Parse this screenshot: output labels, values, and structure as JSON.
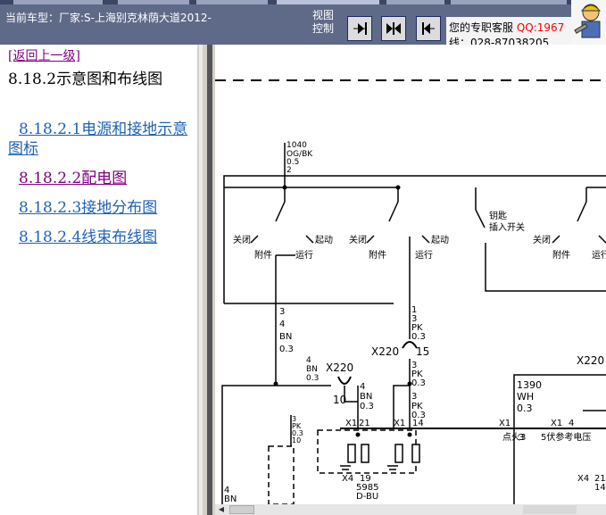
{
  "header": {
    "car_label": "当前车型：厂家:S-上海别克林荫大道2012-",
    "view_label": "视图控制",
    "contact_text": "您的专职客服",
    "qq_label": "QQ:1967",
    "phone": "线：028-87038205"
  },
  "nav_buttons": [
    {
      "name": "next-page",
      "icon": "arrow-right-bar-icon"
    },
    {
      "name": "split-view",
      "icon": "split-arrows-icon"
    },
    {
      "name": "prev-page",
      "icon": "arrow-left-bar-icon"
    }
  ],
  "sidebar": {
    "back_link": "[返回上一级]",
    "section_title": "8.18.2示意图和布线图",
    "items": [
      {
        "label": "8.18.2.1电源和接地示意图标",
        "color": "#1f62b4"
      },
      {
        "label": "8.18.2.2配电图",
        "color": "#800080"
      },
      {
        "label": "8.18.2.3接地分布图",
        "color": "#1f62b4"
      },
      {
        "label": "8.18.2.4线束布线图",
        "color": "#1f62b4"
      }
    ]
  },
  "diagram": {
    "wire_top": [
      "1040",
      "OG/BK",
      "0.5",
      "2"
    ],
    "switch_labels": {
      "off": "关闭",
      "start": "起动",
      "accessory": "附件",
      "run": "运行",
      "key_in_1": "钥匙",
      "key_in_2": "插入开关"
    },
    "wire_left": [
      "3",
      "4",
      "BN",
      "0.3"
    ],
    "wire_mid": [
      "1",
      "3",
      "PK",
      "0.3"
    ],
    "connector_x220_a": "X220",
    "connector_x220_a_pin": "15",
    "wire_mid2": [
      "3",
      "PK",
      "0.3"
    ],
    "wire_left2": [
      "4",
      "BN",
      "0.3"
    ],
    "connector_x220_b": "X220",
    "connector_x220_b_pin": "10",
    "wire_bn": [
      "4",
      "BN",
      "0.3"
    ],
    "wire_pk": [
      "3",
      "PK",
      "0.3"
    ],
    "wire_small": [
      "3",
      "PK",
      "0.3",
      "10"
    ],
    "connector_x220_c": "X220",
    "wire_right": [
      "1390",
      "WH",
      "0.3"
    ],
    "x1_a": "X1",
    "x1_a_pin": "21",
    "x1_b": "X1",
    "x1_b_pin": "14",
    "x1_c": "X1",
    "x1_c_pin": "3",
    "x1_d": "X1",
    "x1_d_pin": "4",
    "ignition_label": "点火3",
    "ref_voltage": "5伏参考电压",
    "x4_a": "X4",
    "x4_a_pin": "19",
    "x4_a_wire": [
      "5985",
      "D-BU"
    ],
    "x4_b": "X4",
    "x4_b_pin": "21",
    "x4_b_wire": "143",
    "bottom_left": [
      "4",
      "BN"
    ]
  }
}
